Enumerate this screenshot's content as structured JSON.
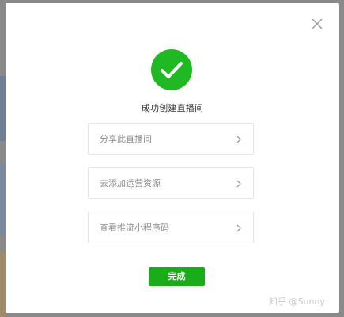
{
  "dialog": {
    "title": "成功创建直播间",
    "options": [
      {
        "label": "分享此直播间"
      },
      {
        "label": "去添加运营资源"
      },
      {
        "label": "查看推流小程序码"
      }
    ],
    "done_label": "完成",
    "close_icon": "close-icon",
    "success_icon": "check-circle-icon"
  },
  "watermark": {
    "text": "知乎 @Sunny"
  },
  "colors": {
    "accent": "#1aad19",
    "success_circle": "#21b923",
    "border": "#e4e4e4",
    "label": "#8c8c8c"
  }
}
